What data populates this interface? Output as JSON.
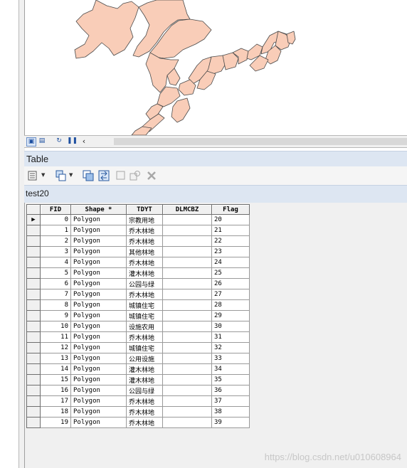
{
  "table_window": {
    "title": "Table",
    "layer_name": "test20"
  },
  "icons": {
    "map_toolbar": [
      "layout-view-icon",
      "data-view-icon",
      "refresh-icon",
      "pause-icon",
      "scroll-left-icon"
    ],
    "table_toolbar": [
      "table-options-icon",
      "related-tables-icon",
      "select-by-attributes-icon",
      "switch-selection-icon",
      "clear-selection-icon",
      "zoom-to-selected-icon",
      "delete-selected-icon"
    ]
  },
  "colors": {
    "polygon_fill": "#f9cdb8",
    "polygon_stroke": "#4a4a4a",
    "header_bar": "#dde6f2"
  },
  "attribute_table": {
    "columns": [
      "FID",
      "Shape *",
      "TDYT",
      "DLMCBZ",
      "Flag"
    ],
    "rows": [
      {
        "fid": "0",
        "shape": "Polygon",
        "tdyt": "宗教用地",
        "dlmcbz": "",
        "flag": "20"
      },
      {
        "fid": "1",
        "shape": "Polygon",
        "tdyt": "乔木林地",
        "dlmcbz": "",
        "flag": "21"
      },
      {
        "fid": "2",
        "shape": "Polygon",
        "tdyt": "乔木林地",
        "dlmcbz": "",
        "flag": "22"
      },
      {
        "fid": "3",
        "shape": "Polygon",
        "tdyt": "其他林地",
        "dlmcbz": "",
        "flag": "23"
      },
      {
        "fid": "4",
        "shape": "Polygon",
        "tdyt": "乔木林地",
        "dlmcbz": "",
        "flag": "24"
      },
      {
        "fid": "5",
        "shape": "Polygon",
        "tdyt": "灌木林地",
        "dlmcbz": "",
        "flag": "25"
      },
      {
        "fid": "6",
        "shape": "Polygon",
        "tdyt": "公园与绿",
        "dlmcbz": "",
        "flag": "26"
      },
      {
        "fid": "7",
        "shape": "Polygon",
        "tdyt": "乔木林地",
        "dlmcbz": "",
        "flag": "27"
      },
      {
        "fid": "8",
        "shape": "Polygon",
        "tdyt": "城镇住宅",
        "dlmcbz": "",
        "flag": "28"
      },
      {
        "fid": "9",
        "shape": "Polygon",
        "tdyt": "城镇住宅",
        "dlmcbz": "",
        "flag": "29"
      },
      {
        "fid": "10",
        "shape": "Polygon",
        "tdyt": "设施农用",
        "dlmcbz": "",
        "flag": "30"
      },
      {
        "fid": "11",
        "shape": "Polygon",
        "tdyt": "乔木林地",
        "dlmcbz": "",
        "flag": "31"
      },
      {
        "fid": "12",
        "shape": "Polygon",
        "tdyt": "城镇住宅",
        "dlmcbz": "",
        "flag": "32"
      },
      {
        "fid": "13",
        "shape": "Polygon",
        "tdyt": "公用设施",
        "dlmcbz": "",
        "flag": "33"
      },
      {
        "fid": "14",
        "shape": "Polygon",
        "tdyt": "灌木林地",
        "dlmcbz": "",
        "flag": "34"
      },
      {
        "fid": "15",
        "shape": "Polygon",
        "tdyt": "灌木林地",
        "dlmcbz": "",
        "flag": "35"
      },
      {
        "fid": "16",
        "shape": "Polygon",
        "tdyt": "公园与绿",
        "dlmcbz": "",
        "flag": "36"
      },
      {
        "fid": "17",
        "shape": "Polygon",
        "tdyt": "乔木林地",
        "dlmcbz": "",
        "flag": "37"
      },
      {
        "fid": "18",
        "shape": "Polygon",
        "tdyt": "乔木林地",
        "dlmcbz": "",
        "flag": "38"
      },
      {
        "fid": "19",
        "shape": "Polygon",
        "tdyt": "乔木林地",
        "dlmcbz": "",
        "flag": "39"
      }
    ]
  },
  "watermark": "https://blog.csdn.net/u010608964"
}
